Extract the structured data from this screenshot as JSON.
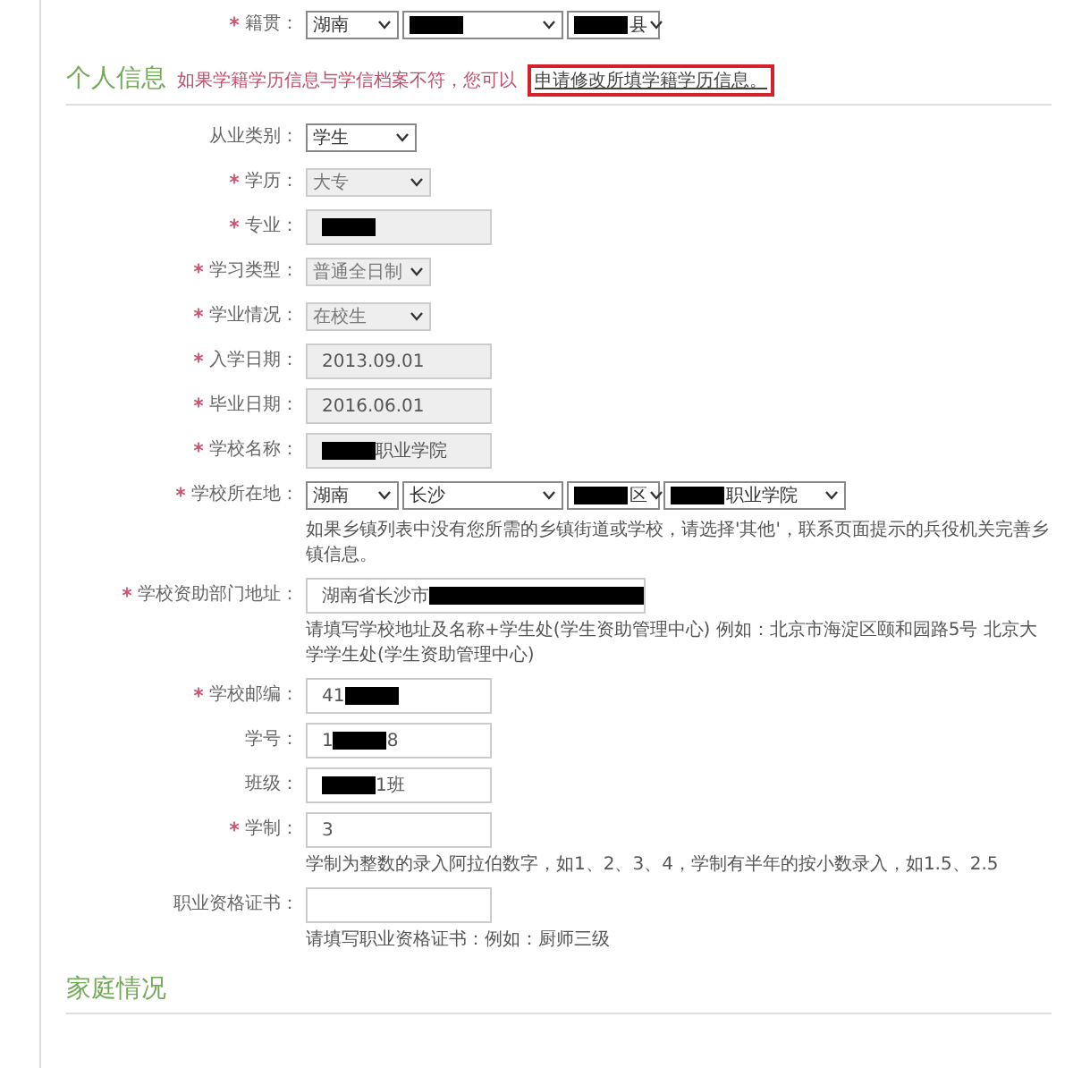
{
  "upper_fields": [
    {
      "label": "籍贯：",
      "required": true,
      "kind": "selects",
      "disabled": false,
      "selects": [
        {
          "value": "湖南"
        },
        {
          "redacted": true
        },
        {
          "redacted": true,
          "value_after": "县"
        }
      ]
    }
  ],
  "personal_info": {
    "title": "个人信息",
    "notice": "如果学籍学历信息与学信档案不符，您可以",
    "link": "申请修改所填学籍学历信息。",
    "fields": [
      {
        "label": "从业类别：",
        "required": false,
        "kind": "select",
        "disabled": false,
        "value": "学生"
      },
      {
        "label": "学历：",
        "required": true,
        "kind": "select",
        "disabled": true,
        "value": "大专"
      },
      {
        "label": "专业：",
        "required": true,
        "kind": "text",
        "disabled": true,
        "redacted": true
      },
      {
        "label": "学习类型：",
        "required": true,
        "kind": "select",
        "disabled": true,
        "value": "普通全日制"
      },
      {
        "label": "学业情况：",
        "required": true,
        "kind": "select",
        "disabled": true,
        "value": "在校生"
      },
      {
        "label": "入学日期：",
        "required": true,
        "kind": "text",
        "disabled": true,
        "value": "2013.09.01"
      },
      {
        "label": "毕业日期：",
        "required": true,
        "kind": "text",
        "disabled": true,
        "value": "2016.06.01"
      },
      {
        "label": "学校名称：",
        "required": true,
        "kind": "text",
        "disabled": true,
        "redacted": true,
        "value_after": "职业学院"
      },
      {
        "label": "学校所在地：",
        "required": true,
        "kind": "selects",
        "disabled": false,
        "selects": [
          {
            "value": "湖南"
          },
          {
            "value": "长沙"
          },
          {
            "redacted": true,
            "value_after": "区"
          },
          {
            "redacted": true,
            "value_after": "职业学院"
          }
        ],
        "note": "如果乡镇列表中没有您所需的乡镇街道或学校，请选择'其他'，联系页面提示的兵役机关完善乡镇信息。"
      },
      {
        "label": "学校资助部门地址：",
        "required": true,
        "kind": "long_text",
        "disabled": false,
        "value": "湖南省长沙市",
        "redacted": true,
        "note": "请填写学校地址及名称+学生处(学生资助管理中心) 例如：北京市海淀区颐和园路5号 北京大学学生处(学生资助管理中心)"
      },
      {
        "label": "学校邮编：",
        "required": true,
        "kind": "text",
        "disabled": false,
        "value": "41",
        "redacted": true
      },
      {
        "label": "学号：",
        "required": false,
        "kind": "text",
        "disabled": false,
        "value": "1",
        "redacted": true,
        "value_after": "8"
      },
      {
        "label": "班级：",
        "required": false,
        "kind": "text",
        "disabled": false,
        "redacted": true,
        "value_after": "1班"
      },
      {
        "label": "学制：",
        "required": true,
        "kind": "text",
        "disabled": false,
        "value": "3",
        "note": "学制为整数的录入阿拉伯数字，如1、2、3、4，学制有半年的按小数录入，如1.5、2.5"
      },
      {
        "label": "职业资格证书：",
        "required": false,
        "kind": "text",
        "disabled": false,
        "note": "请填写职业资格证书：例如：厨师三级"
      }
    ]
  },
  "family_section": {
    "title": "家庭情况"
  }
}
